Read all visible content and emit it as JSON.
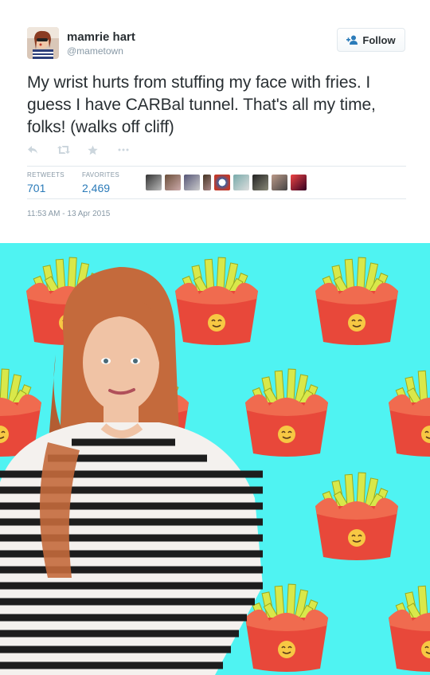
{
  "tweet": {
    "display_name": "mamrie hart",
    "handle": "@mametown",
    "follow_label": "Follow",
    "text": "My wrist hurts from stuffing my face with fries. I guess I have CARBal tunnel. That's all my time, folks! (walks off cliff)",
    "stats": {
      "retweets_label": "RETWEETS",
      "retweets_count": "701",
      "favorites_label": "FAVORITES",
      "favorites_count": "2,469"
    },
    "timestamp": "11:53 AM - 13 Apr 2015"
  },
  "actions": [
    "reply-icon",
    "retweet-icon",
    "favorite-icon",
    "more-icon"
  ],
  "colors": {
    "link": "#2b7bb9",
    "muted": "#8899a6",
    "media_background": "#4ff3f2",
    "fries_box": "#e8483a",
    "fries": "#d9e84a"
  }
}
